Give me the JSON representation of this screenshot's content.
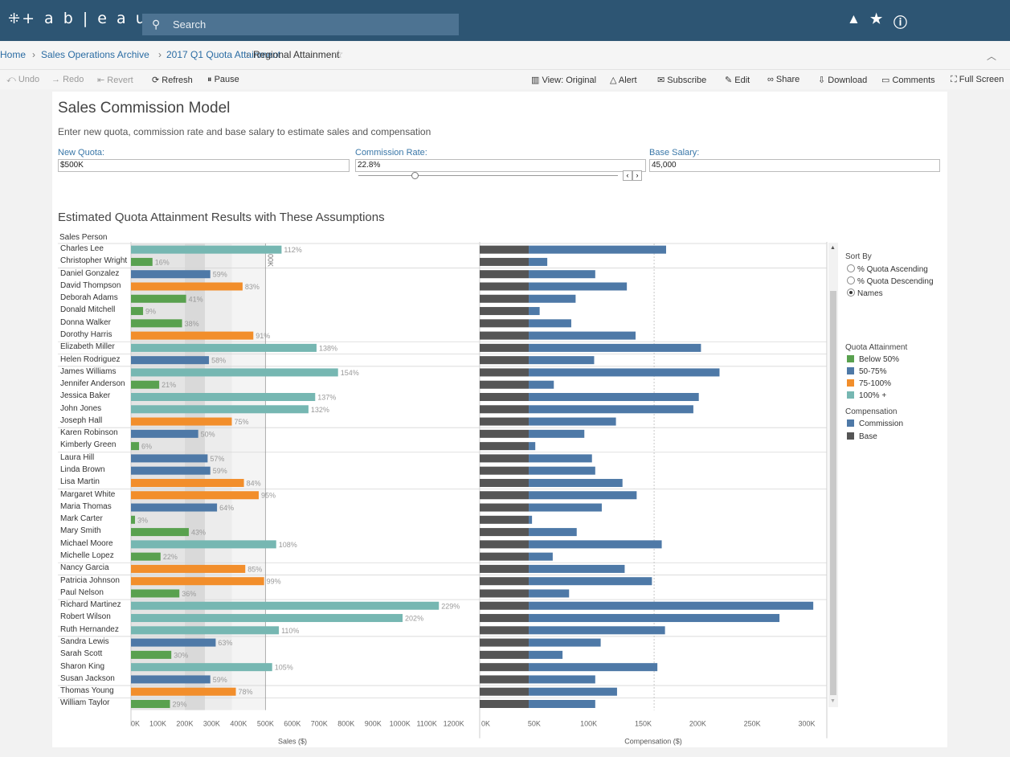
{
  "app": {
    "logo": "+ a b | e a u",
    "search_placeholder": "Search"
  },
  "breadcrumb": [
    "Home",
    "Sales Operations Archive",
    "2017 Q1 Quota Attainment",
    "Regional Attainment"
  ],
  "toolbar": {
    "undo": "Undo",
    "redo": "Redo",
    "revert": "Revert",
    "refresh": "Refresh",
    "pause": "Pause",
    "view": "View: Original",
    "alert": "Alert",
    "subscribe": "Subscribe",
    "edit": "Edit",
    "share": "Share",
    "download": "Download",
    "comments": "Comments",
    "fullscreen": "Full Screen"
  },
  "dashboard": {
    "title": "Sales Commission Model",
    "subtitle": "Enter new quota, commission rate and base salary to estimate sales and compensation",
    "params": {
      "quota_label": "New Quota:",
      "quota_value": "$500K",
      "rate_label": "Commission Rate:",
      "rate_value": "22.8%",
      "salary_label": "Base Salary:",
      "salary_value": "45,000"
    },
    "chart_title": "Estimated Quota Attainment Results with These Assumptions",
    "column_header": "Sales Person",
    "quota_marker": "$500K",
    "sort": {
      "title": "Sort By",
      "options": [
        "% Quota Ascending",
        "% Quota Descending",
        "Names"
      ],
      "selected": "Names"
    },
    "legend": {
      "title": "Quota Attainment",
      "items": [
        {
          "label": "Below 50%",
          "color": "#59a14f"
        },
        {
          "label": "50-75%",
          "color": "#4e79a7"
        },
        {
          "label": "75-100%",
          "color": "#f28e2b"
        },
        {
          "label": "100% +",
          "color": "#76b7b2"
        }
      ],
      "comp_title": "Compensation",
      "comp_items": [
        {
          "label": "Commission",
          "color": "#4e79a7"
        },
        {
          "label": "Base",
          "color": "#555555"
        }
      ]
    }
  },
  "chart_data": {
    "type": "bar",
    "quota": 500,
    "base_salary": 45,
    "sales_axis": {
      "label": "Sales ($)",
      "ticks": [
        "0K",
        "100K",
        "200K",
        "300K",
        "400K",
        "500K",
        "600K",
        "700K",
        "800K",
        "900K",
        "1000K",
        "1100K",
        "1200K"
      ],
      "range": [
        0,
        1200
      ]
    },
    "comp_axis": {
      "label": "Compensation ($)",
      "ticks": [
        "0K",
        "50K",
        "100K",
        "150K",
        "200K",
        "250K",
        "300K"
      ],
      "range": [
        0,
        300
      ]
    },
    "people": [
      {
        "name": "Charles Lee",
        "pct": "112%"
      },
      {
        "name": "Christopher Wright",
        "pct": "16%"
      },
      {
        "name": "Daniel Gonzalez",
        "pct": "59%"
      },
      {
        "name": "David Thompson",
        "pct": "83%"
      },
      {
        "name": "Deborah Adams",
        "pct": "41%"
      },
      {
        "name": "Donald Mitchell",
        "pct": "9%"
      },
      {
        "name": "Donna Walker",
        "pct": "38%"
      },
      {
        "name": "Dorothy Harris",
        "pct": "91%"
      },
      {
        "name": "Elizabeth Miller",
        "pct": "138%"
      },
      {
        "name": "Helen Rodriguez",
        "pct": "58%"
      },
      {
        "name": "James Williams",
        "pct": "154%"
      },
      {
        "name": "Jennifer Anderson",
        "pct": "21%"
      },
      {
        "name": "Jessica Baker",
        "pct": "137%"
      },
      {
        "name": "John Jones",
        "pct": "132%"
      },
      {
        "name": "Joseph Hall",
        "pct": "75%"
      },
      {
        "name": "Karen Robinson",
        "pct": "50%"
      },
      {
        "name": "Kimberly Green",
        "pct": "6%"
      },
      {
        "name": "Laura Hill",
        "pct": "57%"
      },
      {
        "name": "Linda Brown",
        "pct": "59%"
      },
      {
        "name": "Lisa Martin",
        "pct": "84%"
      },
      {
        "name": "Margaret White",
        "pct": "95%"
      },
      {
        "name": "Maria Thomas",
        "pct": "64%"
      },
      {
        "name": "Mark Carter",
        "pct": "3%"
      },
      {
        "name": "Mary Smith",
        "pct": "43%"
      },
      {
        "name": "Michael Moore",
        "pct": "108%"
      },
      {
        "name": "Michelle Lopez",
        "pct": "22%"
      },
      {
        "name": "Nancy Garcia",
        "pct": "85%"
      },
      {
        "name": "Patricia Johnson",
        "pct": "99%"
      },
      {
        "name": "Paul Nelson",
        "pct": "36%"
      },
      {
        "name": "Richard Martinez",
        "pct": "229%"
      },
      {
        "name": "Robert Wilson",
        "pct": "202%"
      },
      {
        "name": "Ruth Hernandez",
        "pct": "110%"
      },
      {
        "name": "Sandra Lewis",
        "pct": "63%"
      },
      {
        "name": "Sarah Scott",
        "pct": "30%"
      },
      {
        "name": "Sharon King",
        "pct": "105%"
      },
      {
        "name": "Susan Jackson",
        "pct": "59%"
      },
      {
        "name": "Thomas Young",
        "pct": "78%"
      },
      {
        "name": "William Taylor",
        "pct": "29%"
      }
    ],
    "commission": [
      126,
      17,
      61,
      90,
      43,
      10,
      39,
      98,
      158,
      60,
      175,
      23,
      156,
      151,
      80,
      51,
      6,
      58,
      61,
      86,
      99,
      67,
      3,
      44,
      122,
      22,
      88,
      113,
      37,
      261,
      230,
      125,
      66,
      31,
      118,
      61,
      81,
      61
    ]
  }
}
